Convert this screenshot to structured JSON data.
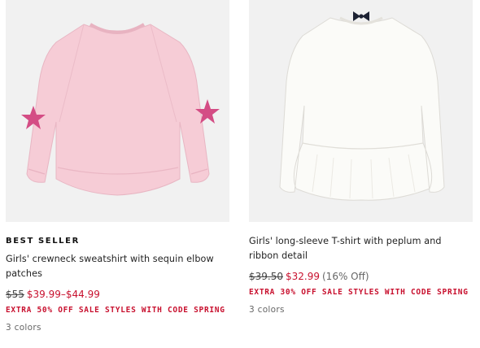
{
  "products": [
    {
      "badge": "BEST SELLER",
      "name": "Girls' crewneck sweatshirt with sequin elbow patches",
      "original_price": "$55",
      "sale_price": "$39.99–$44.99",
      "discount": "",
      "promo": "EXTRA 50% OFF SALE STYLES WITH CODE SPRING",
      "colors": "3 colors",
      "image_colors": {
        "garment": "#f6ccd6",
        "patch": "#d44d85",
        "background": "#f1f1f1"
      }
    },
    {
      "badge": "",
      "name": "Girls' long-sleeve T-shirt with peplum and ribbon detail",
      "original_price": "$39.50",
      "sale_price": "$32.99",
      "discount": "(16% Off)",
      "promo": "EXTRA 30% OFF SALE STYLES WITH CODE SPRING",
      "colors": "3 colors",
      "image_colors": {
        "garment": "#fbfbf8",
        "ribbon": "#1d2233",
        "background": "#f1f1f1"
      }
    }
  ],
  "accent_color": "#c8102e"
}
